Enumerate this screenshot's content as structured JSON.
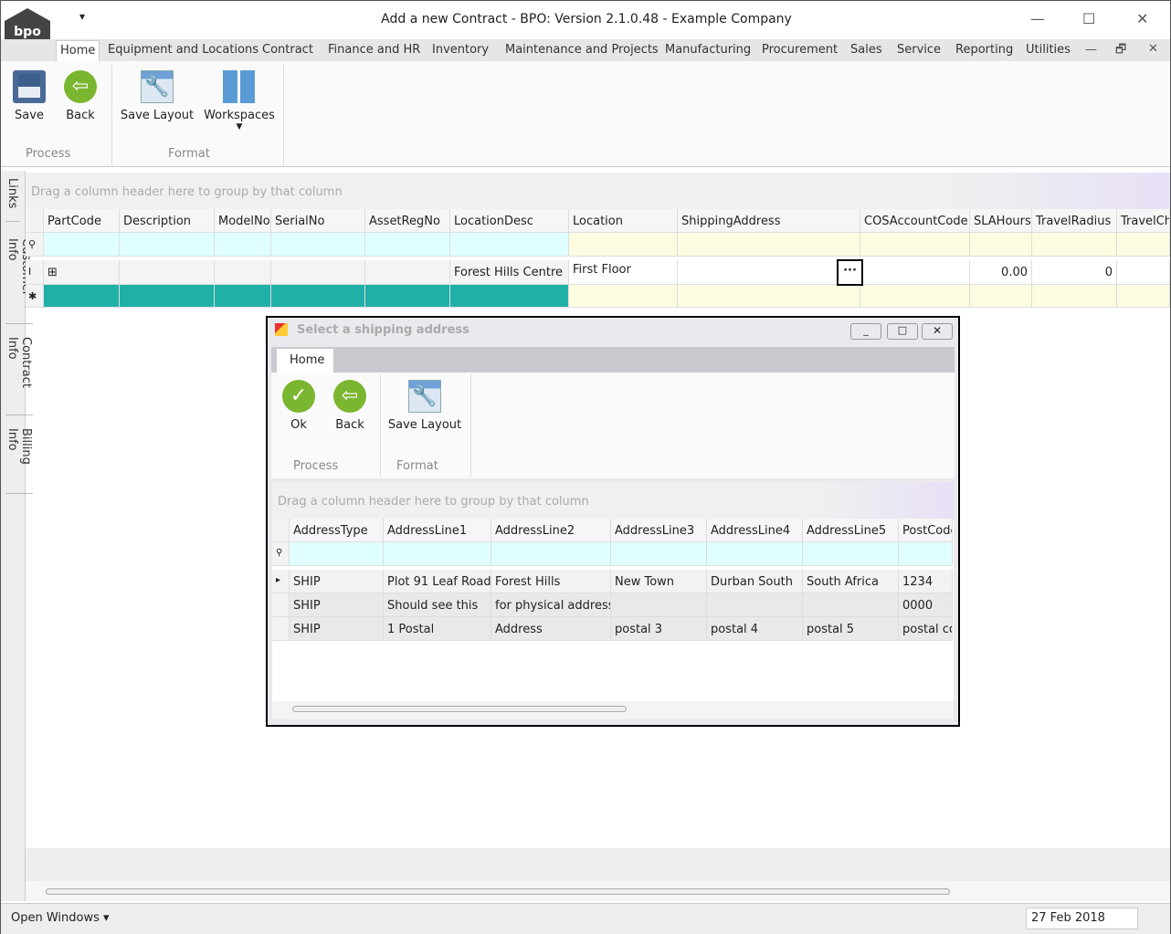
{
  "window": {
    "title": "Add a new Contract - BPO: Version 2.1.0.48 - Example Company",
    "logo": "bpo",
    "qa": "▾",
    "min": "—",
    "max": "☐",
    "close": "✕"
  },
  "tabs": [
    "Home",
    "Equipment and Locations",
    "Contract",
    "Finance and HR",
    "Inventory",
    "Maintenance and Projects",
    "Manufacturing",
    "Procurement",
    "Sales",
    "Service",
    "Reporting",
    "Utilities"
  ],
  "mdi": {
    "min": "—",
    "restore": "🗗",
    "close": "✕"
  },
  "ribbon": {
    "save": "Save",
    "back": "Back",
    "save_layout": "Save Layout",
    "workspaces": "Workspaces",
    "process": "Process",
    "format": "Format"
  },
  "side_tabs": [
    "Links",
    "Customer Info",
    "Contract Info",
    "Billing Info"
  ],
  "grid": {
    "group_hint": "Drag a column header here to group by that column",
    "columns": [
      "PartCode",
      "Description",
      "ModelNo",
      "SerialNo",
      "AssetRegNo",
      "LocationDesc",
      "Location",
      "ShippingAddress",
      "COSAccountCode",
      "SLAHours",
      "TravelRadius",
      "TravelCh"
    ],
    "row": {
      "LocationDesc": "Forest Hills Centre",
      "Location": "First Floor",
      "SLAHours": "0.00",
      "TravelRadius": "0",
      "ellipsis": "···"
    }
  },
  "dialog": {
    "title": "Select a shipping address",
    "tab": "Home",
    "ok": "Ok",
    "back": "Back",
    "save_layout": "Save Layout",
    "process": "Process",
    "format": "Format",
    "group_hint": "Drag a column header here to group by that column",
    "columns": [
      "AddressType",
      "AddressLine1",
      "AddressLine2",
      "AddressLine3",
      "AddressLine4",
      "AddressLine5",
      "PostCode"
    ],
    "rows": [
      [
        "SHIP",
        "Plot 91 Leaf Road",
        "Forest Hills",
        "New Town",
        "Durban South",
        "South Africa",
        "1234"
      ],
      [
        "SHIP",
        "Should see this",
        "for physical address",
        "",
        "",
        "",
        "0000"
      ],
      [
        "SHIP",
        "1 Postal",
        "Address",
        "postal 3",
        "postal 4",
        "postal 5",
        "postal co"
      ]
    ]
  },
  "status": {
    "open_windows": "Open Windows ▾",
    "date": "27 Feb 2018"
  }
}
